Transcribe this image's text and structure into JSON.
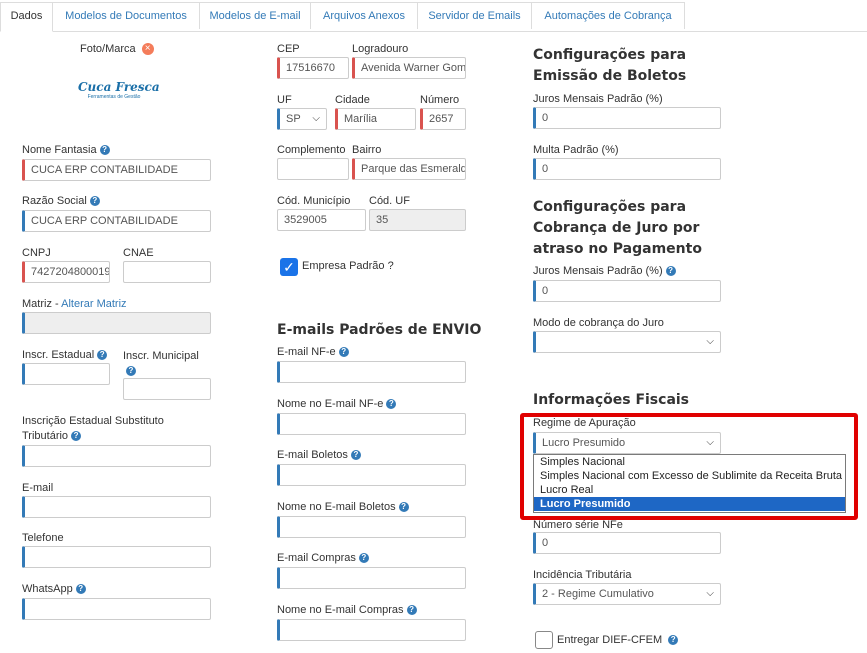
{
  "tabs": [
    "Dados",
    "Modelos de Documentos",
    "Modelos de E-mail",
    "Arquivos Anexos",
    "Servidor de Emails",
    "Automações de Cobrança"
  ],
  "col1": {
    "foto_label": "Foto/Marca",
    "logo_text": "Cuca Fresca",
    "logo_sub": "Ferramentas de Gestão",
    "nome_fantasia_label": "Nome Fantasia",
    "nome_fantasia_value": "CUCA ERP CONTABILIDADE",
    "razao_social_label": "Razão Social",
    "razao_social_value": "CUCA ERP CONTABILIDADE",
    "cnpj_label": "CNPJ",
    "cnpj_value": "7427204800019",
    "cnae_label": "CNAE",
    "matriz_label": "Matriz - ",
    "matriz_link": "Alterar Matriz",
    "ie_label": "Inscr. Estadual",
    "im_label": "Inscr. Municipal",
    "iest_label": "Inscrição Estadual Substituto Tributário",
    "email_label": "E-mail",
    "telefone_label": "Telefone",
    "whatsapp_label": "WhatsApp"
  },
  "col2": {
    "cep_label": "CEP",
    "cep_value": "17516670",
    "logradouro_label": "Logradouro",
    "logradouro_value": "Avenida Warner Gom",
    "uf_label": "UF",
    "uf_value": "SP",
    "cidade_label": "Cidade",
    "cidade_value": "Marília",
    "numero_label": "Número",
    "numero_value": "2657",
    "complemento_label": "Complemento",
    "bairro_label": "Bairro",
    "bairro_value": "Parque das Esmerald",
    "cod_mun_label": "Cód. Município",
    "cod_mun_value": "3529005",
    "cod_uf_label": "Cód. UF",
    "cod_uf_value": "35",
    "empresa_padrao_label": "Empresa Padrão ?",
    "emails_title": "E-mails Padrões de ENVIO",
    "email_nfe_label": "E-mail NF-e",
    "nome_email_nfe_label": "Nome no E-mail NF-e",
    "email_boletos_label": "E-mail Boletos",
    "nome_email_boletos_label": "Nome no E-mail Boletos",
    "email_compras_label": "E-mail Compras",
    "nome_email_compras_label": "Nome no E-mail Compras"
  },
  "col3": {
    "boletos_title": "Configurações para Emissão de Boletos",
    "juros_label": "Juros Mensais Padrão (%)",
    "juros_value": "0",
    "multa_label": "Multa Padrão (%)",
    "multa_value": "0",
    "cobranca_title": "Configurações para Cobrança de Juro por atraso no Pagamento",
    "juros2_label": "Juros Mensais Padrão (%)",
    "juros2_value": "0",
    "modo_label": "Modo de cobrança do Juro",
    "fiscais_title": "Informações Fiscais",
    "regime_label": "Regime de Apuração",
    "regime_value": "Lucro Presumido",
    "regime_options": [
      "Simples Nacional",
      "Simples Nacional com Excesso de Sublimite da Receita Bruta",
      "Lucro Real",
      "Lucro Presumido"
    ],
    "serie_label": "Número série NFe",
    "serie_value": "0",
    "incidencia_label": "Incidência Tributária",
    "incidencia_value": "2 - Regime Cumulativo",
    "dief_label": "Entregar DIEF-CFEM"
  }
}
